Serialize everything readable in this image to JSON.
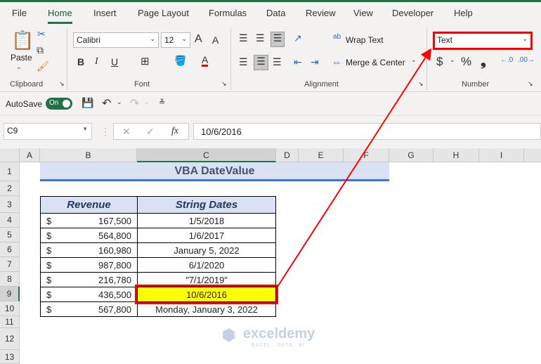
{
  "menu": {
    "tabs": [
      "File",
      "Home",
      "Insert",
      "Page Layout",
      "Formulas",
      "Data",
      "Review",
      "View",
      "Developer",
      "Help"
    ],
    "active": "Home"
  },
  "ribbon": {
    "clipboard": {
      "paste": "Paste",
      "label": "Clipboard"
    },
    "font": {
      "name": "Calibri",
      "size": "12",
      "bold": "B",
      "italic": "I",
      "underline": "U",
      "font_color": "A",
      "grow": "A",
      "shrink": "A",
      "label": "Font"
    },
    "alignment": {
      "wrap": "Wrap Text",
      "merge": "Merge & Center",
      "label": "Alignment"
    },
    "number": {
      "format": "Text",
      "currency": "$",
      "percent": "%",
      "comma": "❟",
      "label": "Number"
    }
  },
  "qat": {
    "autosave": "AutoSave",
    "toggle": "On"
  },
  "formula_bar": {
    "name_box": "C9",
    "fx": "fx",
    "value": "10/6/2016"
  },
  "columns": [
    "A",
    "B",
    "C",
    "D",
    "E",
    "F",
    "G",
    "H",
    "I"
  ],
  "rows": [
    "1",
    "2",
    "3",
    "4",
    "5",
    "6",
    "7",
    "8",
    "9",
    "10",
    "11",
    "12",
    "13"
  ],
  "sheet": {
    "title": "VBA DateValue",
    "headers": [
      "Revenue",
      "String Dates"
    ],
    "data": [
      {
        "cur": "$",
        "revenue": "167,500",
        "date": "1/5/2018"
      },
      {
        "cur": "$",
        "revenue": "564,800",
        "date": "1/6/2017"
      },
      {
        "cur": "$",
        "revenue": "160,980",
        "date": "January 5, 2022"
      },
      {
        "cur": "$",
        "revenue": "987,800",
        "date": "6/1/2020"
      },
      {
        "cur": "$",
        "revenue": "216,780",
        "date": "\"7/1/2019\""
      },
      {
        "cur": "$",
        "revenue": "436,500",
        "date": "10/6/2016"
      },
      {
        "cur": "$",
        "revenue": "567,800",
        "date": "Monday, January 3, 2022"
      }
    ]
  },
  "watermark": {
    "name": "exceldemy",
    "tagline": "EXCEL · DATA · BI"
  },
  "colors": {
    "accent": "#217346",
    "highlight": "#ffff00",
    "annotation": "#ff0000",
    "header_fill": "#d9e1f2"
  }
}
